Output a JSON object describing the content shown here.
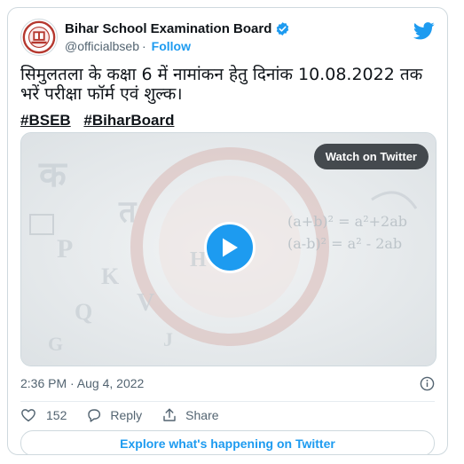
{
  "account": {
    "name": "Bihar School Examination Board",
    "handle": "@officialbseb",
    "separator": "·",
    "follow_label": "Follow"
  },
  "tweet": {
    "text": "सिमुलतला के कक्षा 6 में नामांकन हेतु दिनांक 10.08.2022 तक भरें परीक्षा फॉर्म एवं शुल्क।",
    "hashtags": [
      "#BSEB",
      "#BiharBoard"
    ],
    "timestamp": "2:36 PM · Aug 4, 2022"
  },
  "media": {
    "watch_label": "Watch on Twitter",
    "formula_1": "(a+b)² = a²+2ab",
    "formula_2": "(a-b)² = a² - 2ab"
  },
  "actions": {
    "like_count": "152",
    "reply_label": "Reply",
    "share_label": "Share"
  },
  "explore_label": "Explore what's happening on Twitter",
  "colors": {
    "accent": "#1d9bf0",
    "text": "#0f1419",
    "muted": "#536471",
    "border": "#cfd9de"
  },
  "icons": [
    "bseb-logo",
    "verified-badge-icon",
    "twitter-bird-icon",
    "play-icon",
    "info-icon",
    "heart-icon",
    "reply-icon",
    "share-icon"
  ]
}
